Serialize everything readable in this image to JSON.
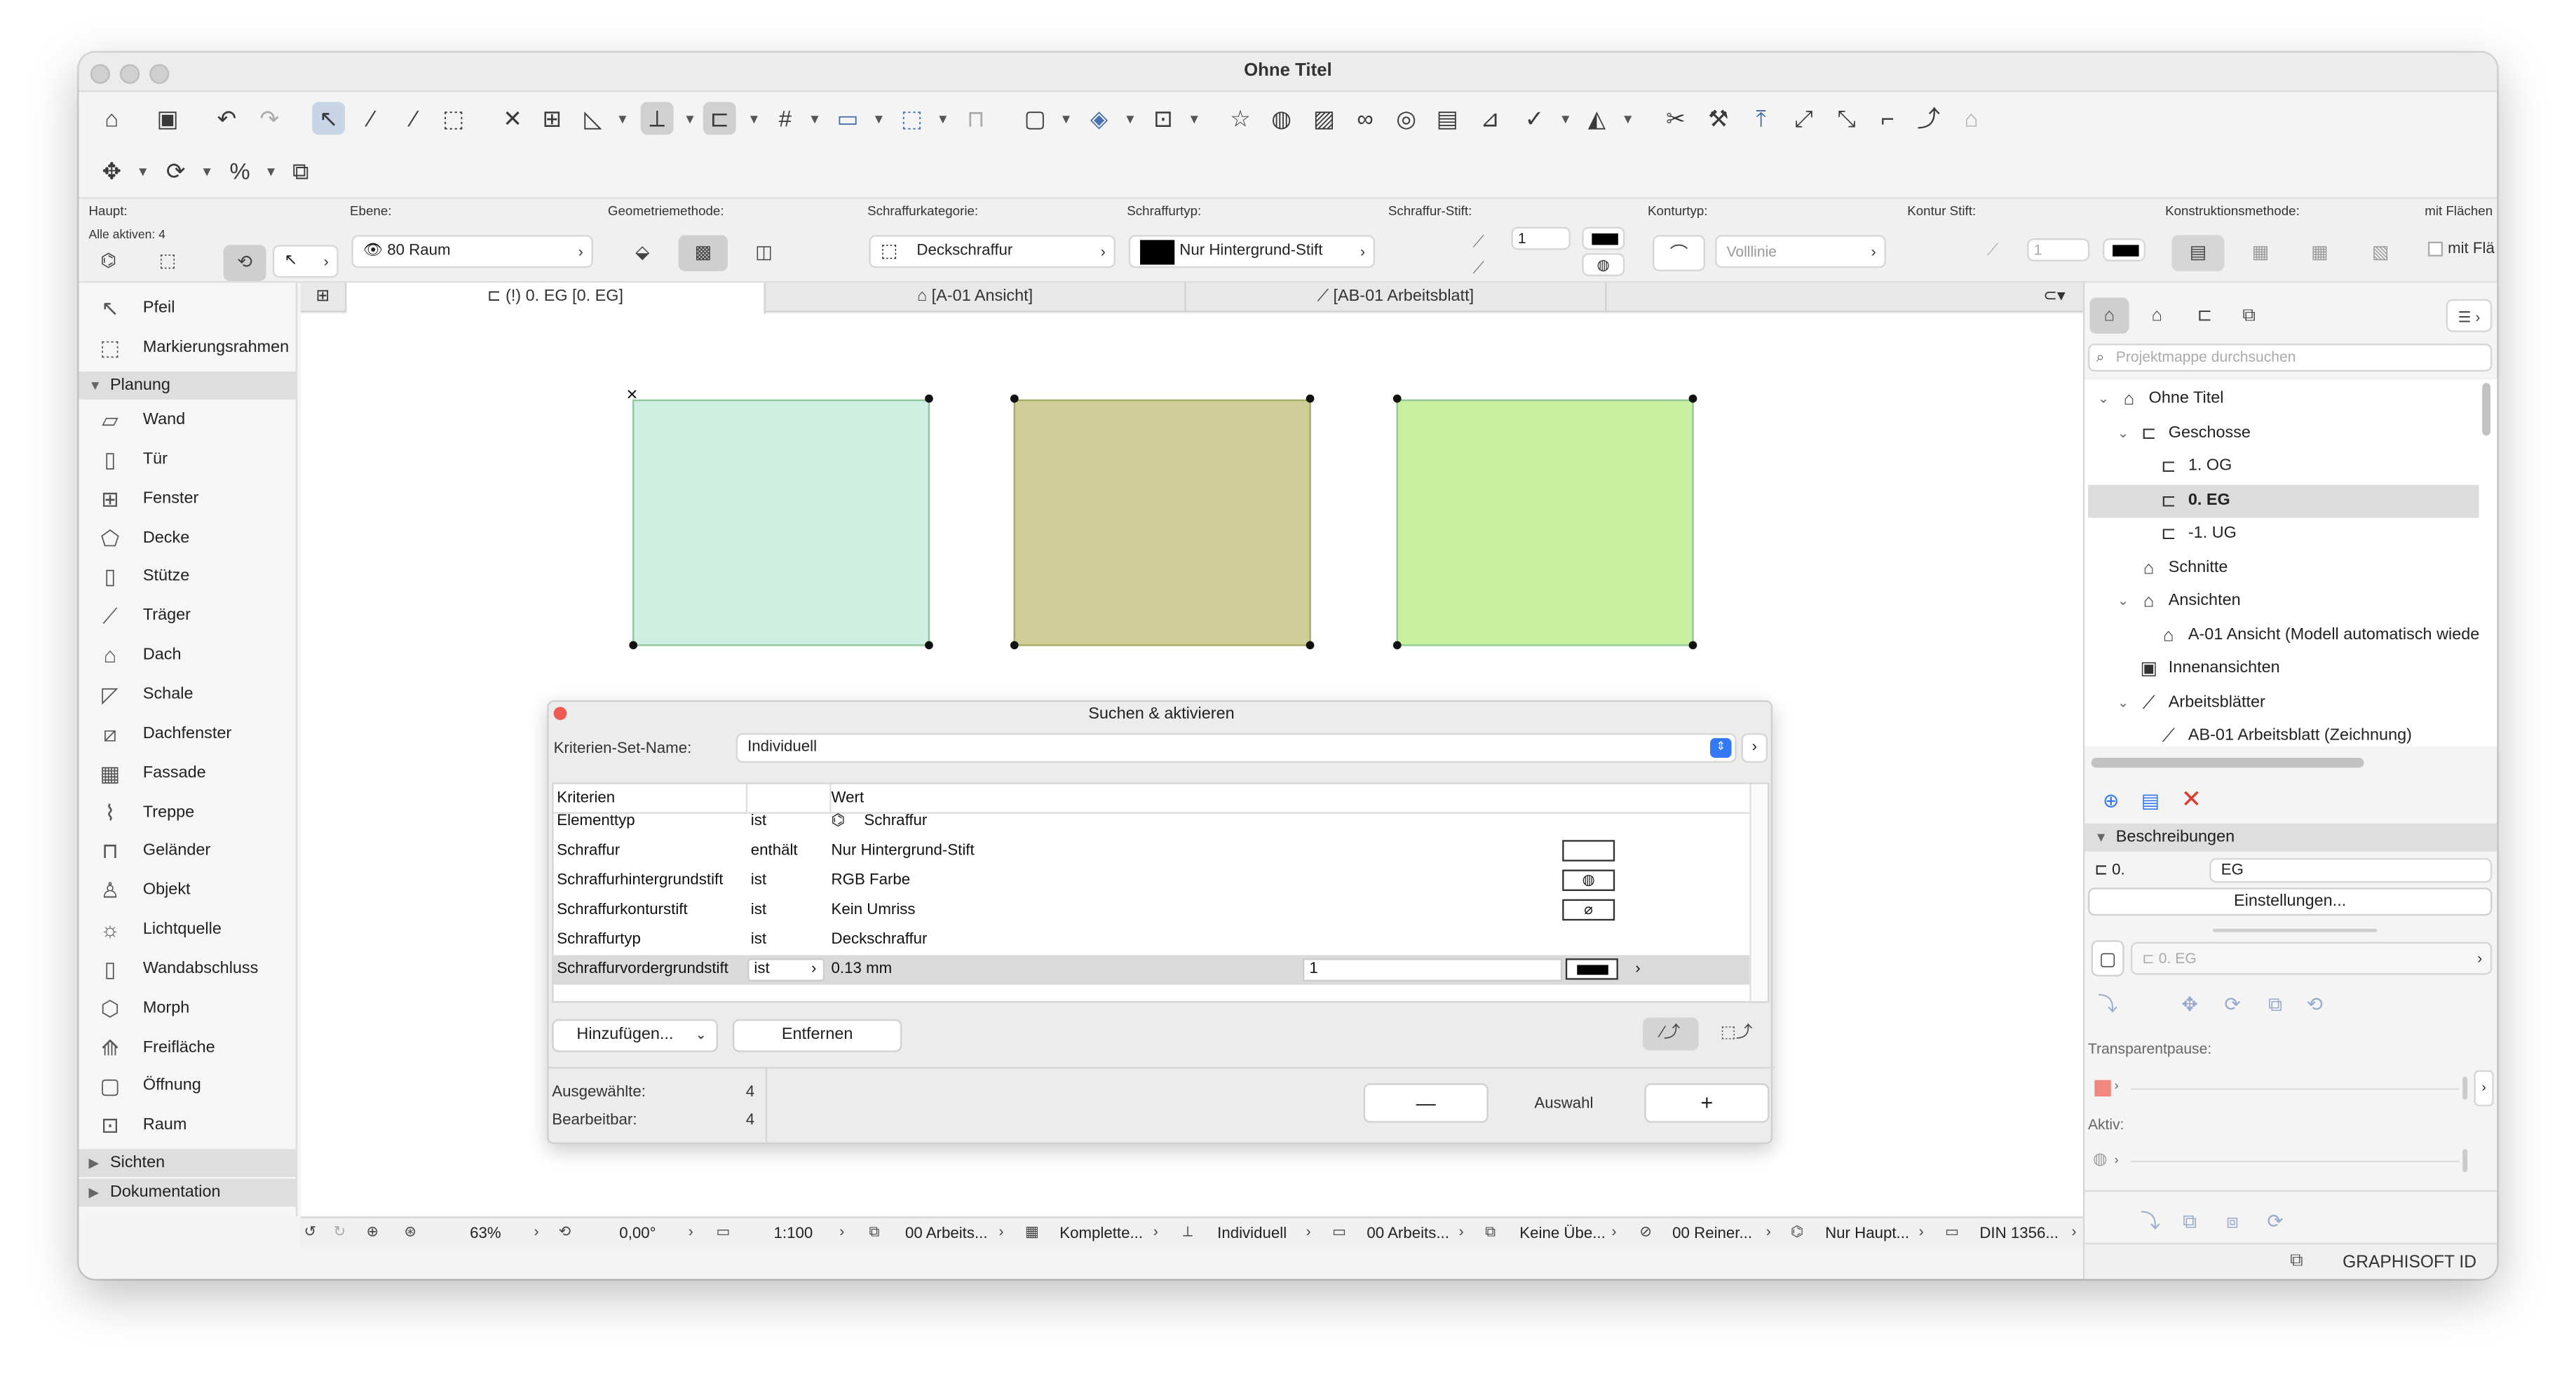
{
  "window": {
    "title": "Ohne Titel"
  },
  "info_box": {
    "haupt_label": "Haupt:",
    "alle_aktiven": "Alle aktiven: 4",
    "ebene_label": "Ebene:",
    "ebene_value": "80 Raum",
    "geometrie_label": "Geometriemethode:",
    "kategorie_label": "Schraffurkategorie:",
    "kategorie_value": "Deckschraffur",
    "typ_label": "Schraffurtyp:",
    "typ_value": "Nur Hintergrund-Stift",
    "stift_label": "Schraffur-Stift:",
    "stift_value": "1",
    "konturtyp_label": "Konturtyp:",
    "konturtyp_value": "Volllinie",
    "kontur_stift_label": "Kontur Stift:",
    "kontur_stift_value": "1",
    "konstruktion_label": "Konstruktionsmethode:",
    "mit_flaechen_label": "mit Flächen",
    "mit_flaechen_checkbox": "mit Flä"
  },
  "toolbox": {
    "top": [
      {
        "icon": "arrow-icon",
        "label": "Pfeil"
      },
      {
        "icon": "marquee-icon",
        "label": "Markierungsrahmen"
      }
    ],
    "planung_header": "Planung",
    "planung_items": [
      {
        "icon": "wall-icon",
        "label": "Wand"
      },
      {
        "icon": "door-icon",
        "label": "Tür"
      },
      {
        "icon": "window-icon",
        "label": "Fenster"
      },
      {
        "icon": "slab-icon",
        "label": "Decke"
      },
      {
        "icon": "column-icon",
        "label": "Stütze"
      },
      {
        "icon": "beam-icon",
        "label": "Träger"
      },
      {
        "icon": "roof-icon",
        "label": "Dach"
      },
      {
        "icon": "shell-icon",
        "label": "Schale"
      },
      {
        "icon": "skylight-icon",
        "label": "Dachfenster"
      },
      {
        "icon": "curtain-wall-icon",
        "label": "Fassade"
      },
      {
        "icon": "stair-icon",
        "label": "Treppe"
      },
      {
        "icon": "railing-icon",
        "label": "Geländer"
      },
      {
        "icon": "object-icon",
        "label": "Objekt"
      },
      {
        "icon": "lamp-icon",
        "label": "Lichtquelle"
      },
      {
        "icon": "wall-end-icon",
        "label": "Wandabschluss"
      },
      {
        "icon": "morph-icon",
        "label": "Morph"
      },
      {
        "icon": "mesh-icon",
        "label": "Freifläche"
      },
      {
        "icon": "opening-icon",
        "label": "Öffnung"
      },
      {
        "icon": "zone-icon",
        "label": "Raum"
      }
    ],
    "sichten_header": "Sichten",
    "dokumentation_header": "Dokumentation"
  },
  "tabs": [
    {
      "label": "(!) 0. EG [0. EG]",
      "active": true
    },
    {
      "label": "[A-01 Ansicht]",
      "active": false
    },
    {
      "label": "[AB-01 Arbeitsblatt]",
      "active": false
    }
  ],
  "hatches": {
    "colors": [
      "#ceefe2",
      "#d0ce98",
      "#c8f0a0"
    ]
  },
  "dialog": {
    "title": "Suchen & aktivieren",
    "set_label": "Kriterien-Set-Name:",
    "set_value": "Individuell",
    "col_kriterien": "Kriterien",
    "col_wert": "Wert",
    "rows": [
      {
        "kriterium": "Elementtyp",
        "op": "ist",
        "wert": "Schraffur",
        "swatch": ""
      },
      {
        "kriterium": "Schraffur",
        "op": "enthält",
        "wert": "Nur Hintergrund-Stift",
        "swatch": "blank"
      },
      {
        "kriterium": "Schraffurhintergrundstift",
        "op": "ist",
        "wert": "RGB Farbe",
        "swatch": "rgb"
      },
      {
        "kriterium": "Schraffurkonturstift",
        "op": "ist",
        "wert": "Kein Umriss",
        "swatch": "none"
      },
      {
        "kriterium": "Schraffurtyp",
        "op": "ist",
        "wert": "Deckschraffur",
        "swatch": ""
      },
      {
        "kriterium": "Schraffurvordergrundstift",
        "op": "ist",
        "wert": "0.13 mm",
        "pen": "1",
        "swatch": "pen"
      }
    ],
    "add_button": "Hinzufügen...",
    "remove_button": "Entfernen",
    "ausgewaehlte_label": "Ausgewählte:",
    "ausgewaehlte_value": "4",
    "bearbeitbar_label": "Bearbeitbar:",
    "bearbeitbar_value": "4",
    "minus_label": "—",
    "auswahl_label": "Auswahl",
    "plus_label": "+"
  },
  "status_bar": {
    "zoom": "63%",
    "angle": "0,00°",
    "scale": "1:100",
    "layer_combo": "00 Arbeits...",
    "model_view": "Komplette...",
    "pen_set": "Individuell",
    "override": "00 Arbeits...",
    "renovation": "Keine Übe...",
    "structure": "00 Reiner...",
    "hatch_display": "Nur Haupt...",
    "dimension": "DIN 1356..."
  },
  "navigator": {
    "search_placeholder": "Projektmappe durchsuchen",
    "items": [
      {
        "indent": 0,
        "caret": "v",
        "icon": "project-icon",
        "label": "Ohne Titel",
        "bold": false,
        "selected": false
      },
      {
        "indent": 1,
        "caret": "v",
        "icon": "folder-icon",
        "label": "Geschosse",
        "bold": false,
        "selected": false
      },
      {
        "indent": 2,
        "caret": "",
        "icon": "story-icon",
        "label": "1. OG",
        "bold": false,
        "selected": false
      },
      {
        "indent": 2,
        "caret": "",
        "icon": "story-icon",
        "label": "0. EG",
        "bold": true,
        "selected": true
      },
      {
        "indent": 2,
        "caret": "",
        "icon": "story-icon",
        "label": "-1. UG",
        "bold": false,
        "selected": false
      },
      {
        "indent": 1,
        "caret": "",
        "icon": "section-icon",
        "label": "Schnitte",
        "bold": false,
        "selected": false
      },
      {
        "indent": 1,
        "caret": "v",
        "icon": "elevation-icon",
        "label": "Ansichten",
        "bold": false,
        "selected": false
      },
      {
        "indent": 2,
        "caret": "",
        "icon": "elevation-icon",
        "label": "A-01 Ansicht (Modell automatisch wiede",
        "bold": false,
        "selected": false
      },
      {
        "indent": 1,
        "caret": "",
        "icon": "interior-elevation-icon",
        "label": "Innenansichten",
        "bold": false,
        "selected": false
      },
      {
        "indent": 1,
        "caret": "v",
        "icon": "worksheet-icon",
        "label": "Arbeitsblätter",
        "bold": false,
        "selected": false
      },
      {
        "indent": 2,
        "caret": "",
        "icon": "worksheet-icon",
        "label": "AB-01 Arbeitsblatt (Zeichnung)",
        "bold": false,
        "selected": false
      }
    ],
    "beschreibungen": "Beschreibungen",
    "prop_id": "0.",
    "prop_name": "EG",
    "einstellungen_button": "Einstellungen...",
    "view_field": "0. EG",
    "transparent_label": "Transparentpause:",
    "aktiv_label": "Aktiv:"
  },
  "brand": "GRAPHISOFT ID"
}
